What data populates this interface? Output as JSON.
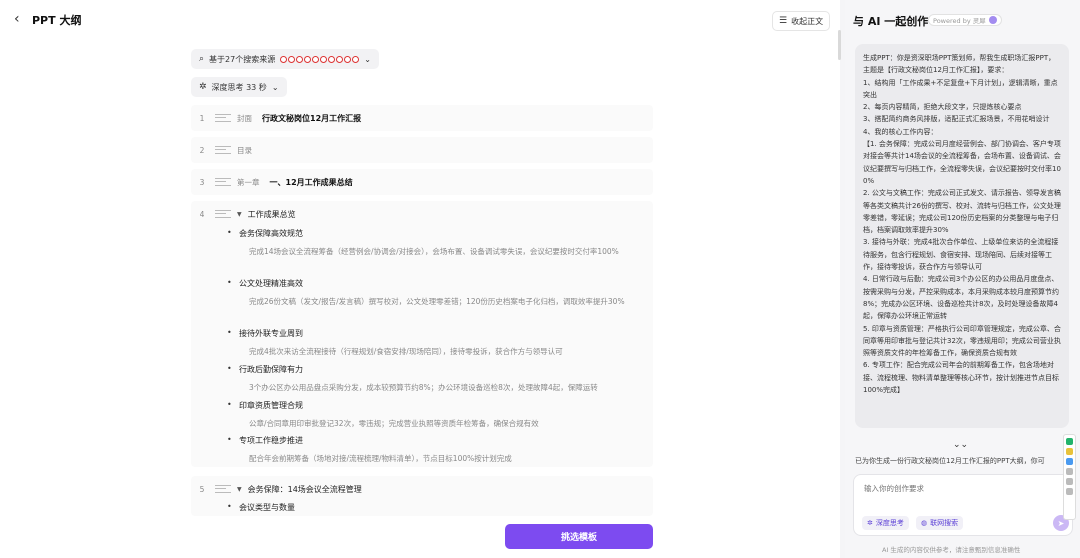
{
  "header": {
    "back_icon": "arrow-left-icon",
    "title": "PPT 大纲",
    "collapse_label": "收起正文"
  },
  "search_pill": {
    "label": "基于27个搜索来源"
  },
  "thinking_pill": {
    "label": "深度思考 33 秒"
  },
  "outline": {
    "rows": [
      {
        "num": "1",
        "kind": "封面",
        "title": "行政文秘岗位12月工作汇报"
      },
      {
        "num": "2",
        "kind": "目录",
        "title": ""
      },
      {
        "num": "3",
        "kind": "第一章",
        "title": "一、12月工作成果总结"
      }
    ],
    "block4": {
      "num": "4",
      "heading": "工作成果总览",
      "items": [
        {
          "title": "会务保障高效规范",
          "desc": "完成14场会议全流程筹备（经营例会/协调会/对接会），会场布置、设备调试零失误，会议纪要按时交付率100%"
        },
        {
          "title": "公文处理精准高效",
          "desc": "完成26份文稿（发文/报告/发言稿）撰写校对，公文处理零差错；120份历史档案电子化归档，调取效率提升30%"
        },
        {
          "title": "接待外联专业周到",
          "desc": "完成4批次来访全流程接待（行程规划/食宿安排/现场陪同），接待零投诉，获合作方与领导认可"
        },
        {
          "title": "行政后勤保障有力",
          "desc": "3个办公区办公用品盘点采购分发，成本较预算节约8%；办公环境设备巡检8次，处理故障4起，保障运转"
        },
        {
          "title": "印章资质管理合规",
          "desc": "公章/合同章用印审批登记32次，零违规；完成营业执照等资质年检筹备，确保合规有效"
        },
        {
          "title": "专项工作稳步推进",
          "desc": "配合年会前期筹备（场地对接/流程梳理/物料清单），节点目标100%按计划完成"
        }
      ]
    },
    "row5": {
      "num": "5",
      "title": "会务保障：14场会议全流程管理",
      "sub": "会议类型与数量"
    }
  },
  "primary_button": {
    "label": "挑选模板"
  },
  "assistant": {
    "title": "与 AI 一起创作",
    "powered": "Powered by 灵犀",
    "prompt": "生成PPT：你是资深职场PPT策划师，帮我生成职场汇报PPT，主题是【行政文秘岗位12月工作汇报】，要求：\n1、结构用「工作成果+不足复盘+下月计划」，逻辑清晰，重点突出\n2、每页内容精简，拒绝大段文字，只提炼核心要点\n3、搭配简约商务风排版，适配正式汇报场景，不用花哨设计\n4、我的核心工作内容：\n【1. 会务保障：完成公司月度经营例会、部门协调会、客户专项对接会等共计14场会议的全流程筹备，会场布置、设备调试、会议纪要撰写与归档工作，全流程零失误，会议纪要按时交付率100%\n2. 公文与文稿工作：完成公司正式发文、请示报告、领导发言稿等各类文稿共计26份的撰写、校对、流转与归档工作，公文处理零差错，零延误；完成公司120份历史档案的分类整理与电子归档，档案调取效率提升30%\n3. 接待与外联：完成4批次合作单位、上级单位来访的全流程接待服务，包含行程规划、食宿安排、现场陪同、后续对接等工作，接待零投诉，获合作方与领导认可\n4. 日常行政与后勤：完成公司3个办公区的办公用品月度盘点、按需采购与分发，严控采购成本，本月采购成本较月度预算节约8%；完成办公区环境、设备巡检共计8次，及时处理设备故障4起，保障办公环境正常运转\n5. 印章与资质管理：严格执行公司印章管理规定，完成公章、合同章等用印审批与登记共计32次，零违规用印；完成公司营业执照等资质文件的年检筹备工作，确保资质合规有效\n6. 专项工作：配合完成公司年会的前期筹备工作，包含场地对接、流程梳理、物料清单整理等核心环节，按计划推进节点目标100%完成】",
    "trail": "已为你生成一份行政文秘岗位12月工作汇报的PPT大纲，你可",
    "input_placeholder": "输入你的创作要求",
    "chip_deep": "深度思考",
    "chip_web": "联网搜索",
    "footer": "AI 生成的内容仅供参考，请注意甄别信息准确性"
  }
}
